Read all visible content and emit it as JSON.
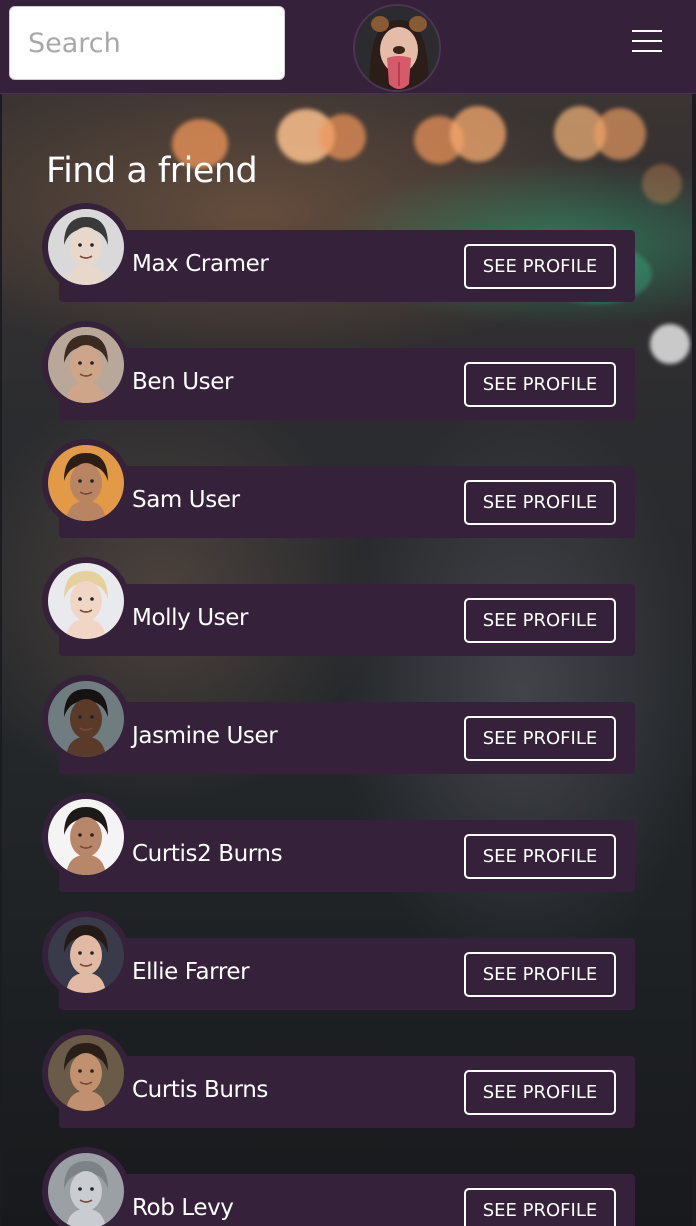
{
  "header": {
    "search": {
      "placeholder": "Search",
      "value": ""
    },
    "avatar_icon": "user-avatar-icon",
    "menu_icon": "hamburger-menu-icon"
  },
  "page": {
    "title": "Find a friend"
  },
  "friends": [
    {
      "name": "Max Cramer",
      "button": "SEE PROFILE",
      "avatar": {
        "bg": "#d9d9d9",
        "skin": "#e8d8cc",
        "hair": "#3a3a3a"
      }
    },
    {
      "name": "Ben User",
      "button": "SEE PROFILE",
      "avatar": {
        "bg": "#b9a89a",
        "skin": "#cfa58a",
        "hair": "#3b2a20"
      }
    },
    {
      "name": "Sam User",
      "button": "SEE PROFILE",
      "avatar": {
        "bg": "#e39a47",
        "skin": "#b88462",
        "hair": "#2b1e16"
      }
    },
    {
      "name": "Molly User",
      "button": "SEE PROFILE",
      "avatar": {
        "bg": "#e9eaee",
        "skin": "#f1d6c6",
        "hair": "#e6d19c"
      }
    },
    {
      "name": "Jasmine User",
      "button": "SEE PROFILE",
      "avatar": {
        "bg": "#6f7c80",
        "skin": "#5a3b2a",
        "hair": "#151212"
      }
    },
    {
      "name": "Curtis2 Burns",
      "button": "SEE PROFILE",
      "avatar": {
        "bg": "#f4f4f4",
        "skin": "#b8876a",
        "hair": "#1c1a18"
      }
    },
    {
      "name": "Ellie Farrer",
      "button": "SEE PROFILE",
      "avatar": {
        "bg": "#3a3b4a",
        "skin": "#e2b9a3",
        "hair": "#241a16"
      }
    },
    {
      "name": "Curtis Burns",
      "button": "SEE PROFILE",
      "avatar": {
        "bg": "#6a5a48",
        "skin": "#c1916f",
        "hair": "#2a1f18"
      }
    },
    {
      "name": "Rob Levy",
      "button": "SEE PROFILE",
      "avatar": {
        "bg": "#9aa0a4",
        "skin": "#c9ccd0",
        "hair": "#7d8287"
      }
    }
  ],
  "colors": {
    "bar": "#35223a",
    "card": "#35223a",
    "text": "#ffffff"
  }
}
